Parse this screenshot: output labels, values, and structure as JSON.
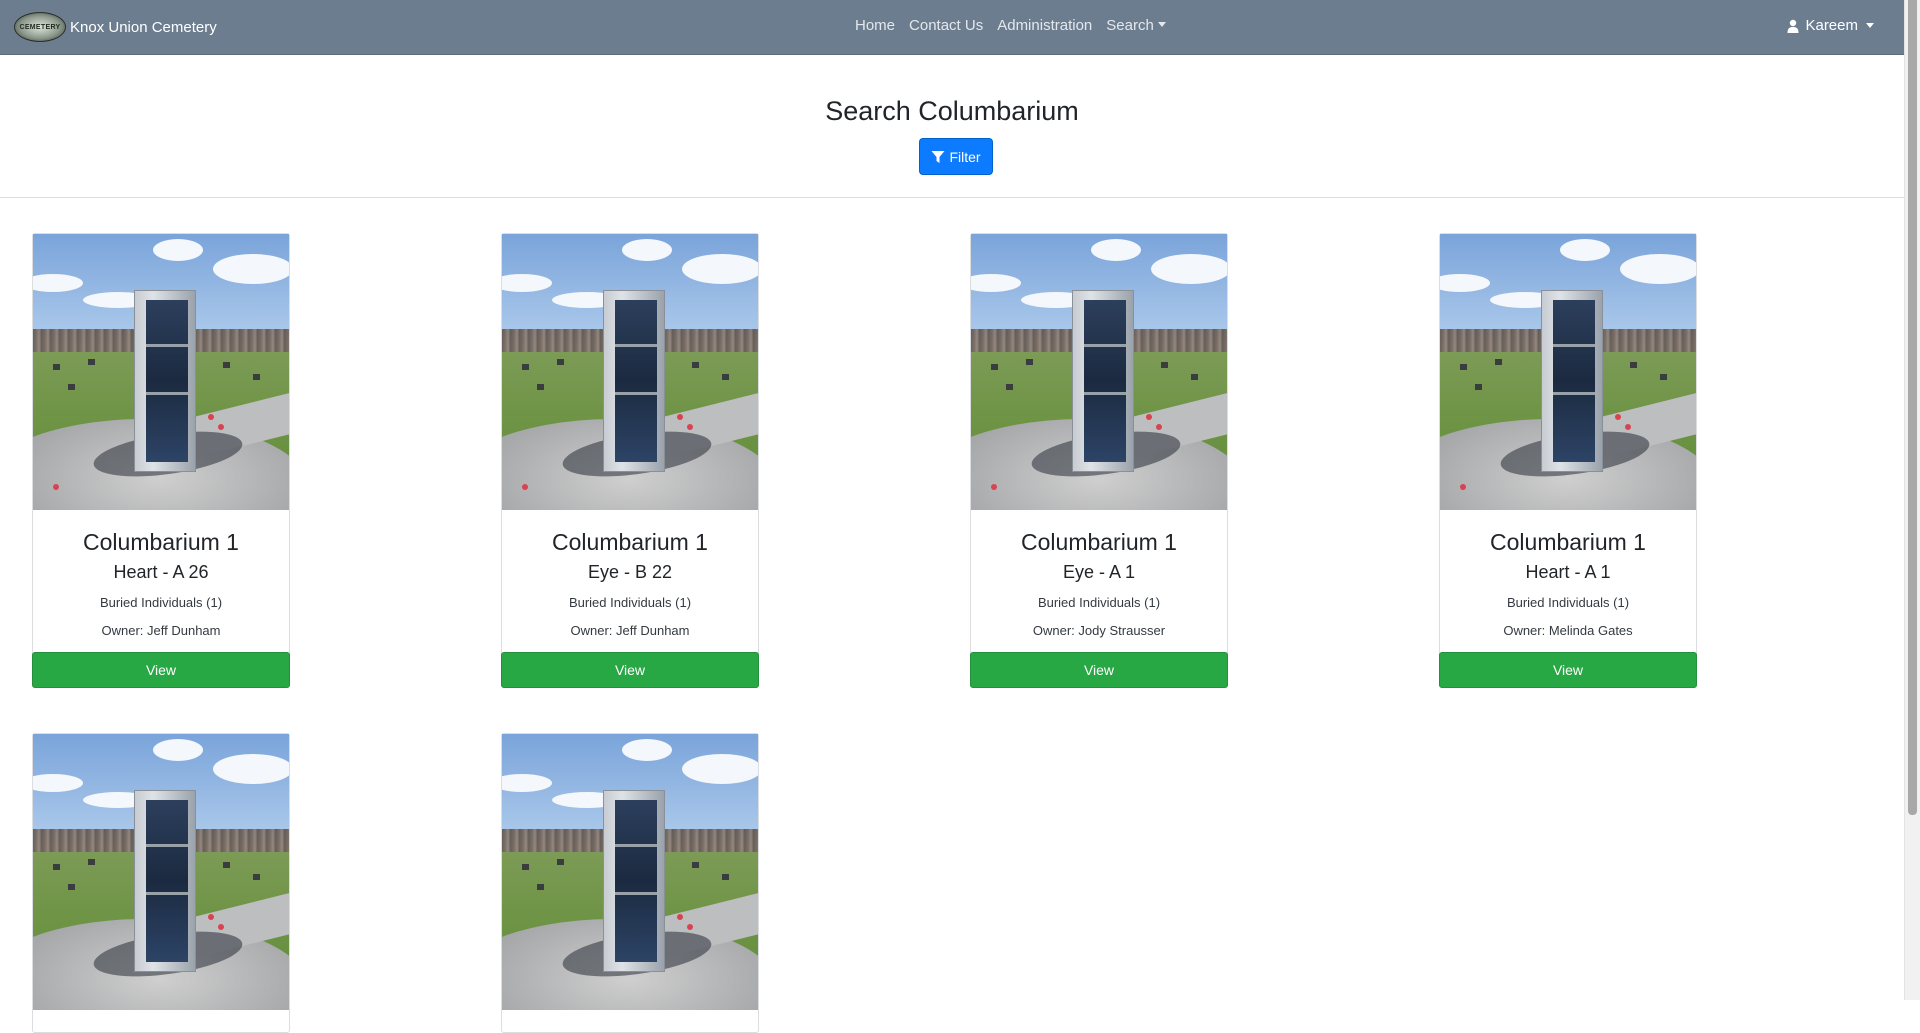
{
  "brand": {
    "logo_text": "CEMETERY",
    "title": "Knox Union Cemetery"
  },
  "nav": {
    "home": "Home",
    "contact": "Contact Us",
    "admin": "Administration",
    "search": "Search"
  },
  "user": {
    "name": "Kareem"
  },
  "page": {
    "title": "Search Columbarium",
    "filter_label": "Filter"
  },
  "cards": [
    {
      "title": "Columbarium 1",
      "subtitle": "Heart - A 26",
      "buried": "Buried Individuals (1)",
      "owner": "Owner: Jeff Dunham",
      "view": "View"
    },
    {
      "title": "Columbarium 1",
      "subtitle": "Eye - B 22",
      "buried": "Buried Individuals (1)",
      "owner": "Owner: Jeff Dunham",
      "view": "View"
    },
    {
      "title": "Columbarium 1",
      "subtitle": "Eye - A 1",
      "buried": "Buried Individuals (1)",
      "owner": "Owner: Jody Strausser",
      "view": "View"
    },
    {
      "title": "Columbarium 1",
      "subtitle": "Heart - A 1",
      "buried": "Buried Individuals (1)",
      "owner": "Owner: Melinda Gates",
      "view": "View"
    },
    {
      "title": "",
      "subtitle": "",
      "buried": "",
      "owner": "",
      "view": ""
    },
    {
      "title": "",
      "subtitle": "",
      "buried": "",
      "owner": "",
      "view": ""
    }
  ],
  "icons": {
    "user": "user-icon",
    "filter": "filter-icon"
  },
  "colors": {
    "navbar": "#6c7d8f",
    "primary": "#0d7bff",
    "success": "#28a745"
  }
}
